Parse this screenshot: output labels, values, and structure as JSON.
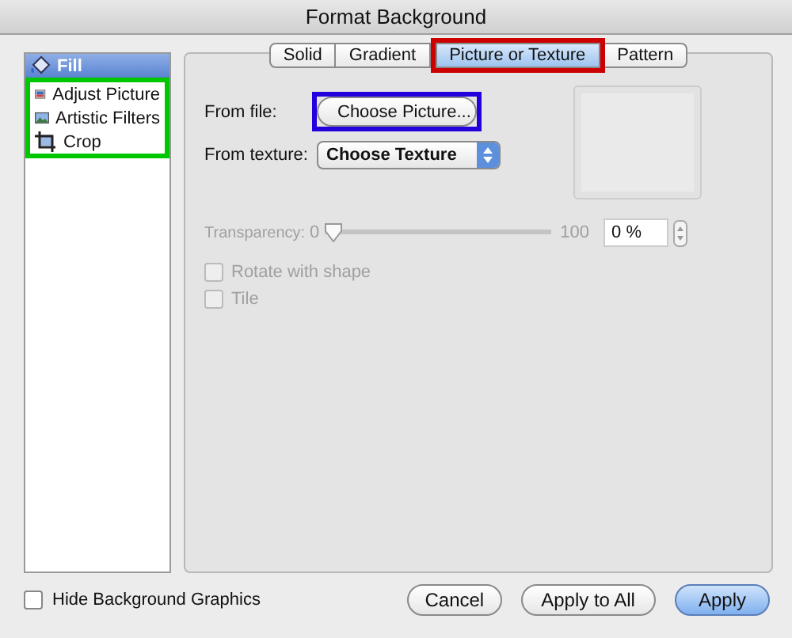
{
  "window": {
    "title": "Format Background"
  },
  "sidebar": {
    "items": [
      {
        "label": "Fill",
        "selected": true
      },
      {
        "label": "Adjust Picture",
        "selected": false,
        "color": "#00c800"
      },
      {
        "label": "Artistic Filters",
        "selected": false,
        "color": "#00c800"
      },
      {
        "label": "Crop",
        "selected": false,
        "color": "#00c800"
      }
    ]
  },
  "tabs": [
    {
      "label": "Solid",
      "selected": false
    },
    {
      "label": "Gradient",
      "selected": false
    },
    {
      "label": "Picture or Texture",
      "selected": true,
      "color": "#cc0000"
    },
    {
      "label": "Pattern",
      "selected": false
    }
  ],
  "from_file": {
    "label": "From file:",
    "button": "Choose Picture...",
    "color": "#2200dd"
  },
  "from_texture": {
    "label": "From texture:",
    "value": "Choose Texture"
  },
  "transparency": {
    "label": "Transparency:",
    "min": "0",
    "max": "100",
    "level": 0,
    "value": "0 %",
    "disabled": true
  },
  "options": [
    {
      "label": "Rotate with shape",
      "checked": false,
      "disabled": true
    },
    {
      "label": "Tile",
      "checked": false,
      "disabled": true
    }
  ],
  "hide_background_graphics": {
    "label": "Hide Background Graphics",
    "checked": false
  },
  "buttons": [
    {
      "label": "Cancel",
      "default": false
    },
    {
      "label": "Apply to All",
      "default": false
    },
    {
      "label": "Apply",
      "default": true
    }
  ]
}
